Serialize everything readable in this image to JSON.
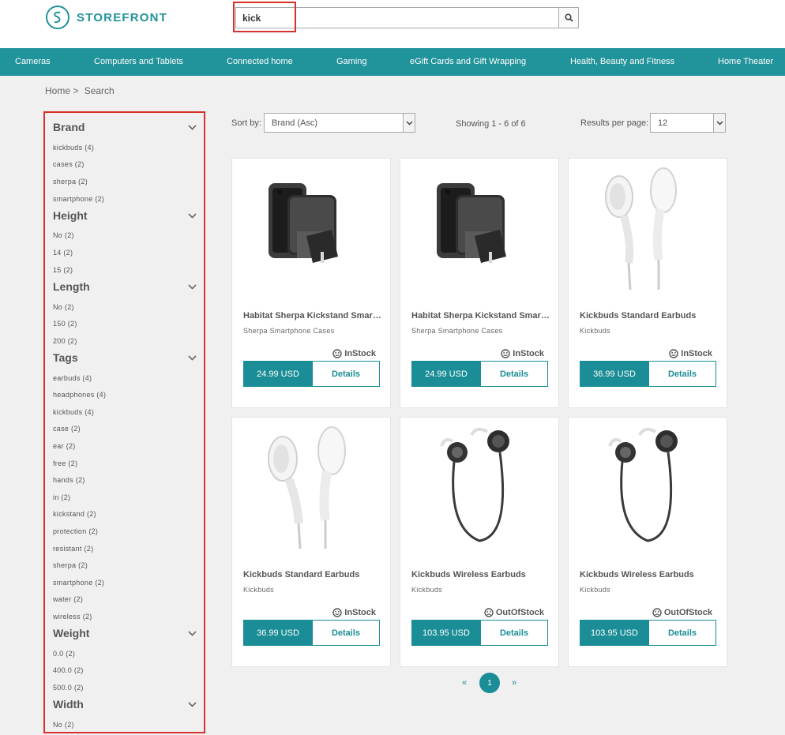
{
  "brand": {
    "name": "STOREFRONT",
    "accent": "#21939a"
  },
  "search": {
    "value": "kick"
  },
  "nav": [
    "Cameras",
    "Computers and Tablets",
    "Connected home",
    "Gaming",
    "eGift Cards and Gift Wrapping",
    "Health, Beauty and Fitness",
    "Home Theater"
  ],
  "breadcrumb": {
    "home": "Home >",
    "current": "Search"
  },
  "facets": [
    {
      "title": "Brand",
      "options": [
        "kickbuds (4)",
        "cases (2)",
        "sherpa (2)",
        "smartphone (2)"
      ]
    },
    {
      "title": "Height",
      "options": [
        "No (2)",
        "14 (2)",
        "15 (2)"
      ]
    },
    {
      "title": "Length",
      "options": [
        "No (2)",
        "150 (2)",
        "200 (2)"
      ]
    },
    {
      "title": "Tags",
      "options": [
        "earbuds (4)",
        "headphones (4)",
        "kickbuds (4)",
        "case (2)",
        "ear (2)",
        "free (2)",
        "hands (2)",
        "in (2)",
        "kickstand (2)",
        "protection (2)",
        "resistant (2)",
        "sherpa (2)",
        "smartphone (2)",
        "water (2)",
        "wireless (2)"
      ]
    },
    {
      "title": "Weight",
      "options": [
        "0.0 (2)",
        "400.0 (2)",
        "500.0 (2)"
      ]
    },
    {
      "title": "Width",
      "options": [
        "No (2)"
      ]
    }
  ],
  "toolbar": {
    "sort_label": "Sort by:",
    "sort_value": "Brand (Asc)",
    "showing": "Showing 1 - 6 of 6",
    "per_page_label": "Results per page:",
    "per_page_value": "12"
  },
  "products": [
    {
      "name": "Habitat Sherpa Kickstand Smartphone Case",
      "brand": "Sherpa Smartphone Cases",
      "stock": "InStock",
      "price": "24.99 USD",
      "details": "Details",
      "image": "phone-case"
    },
    {
      "name": "Habitat Sherpa Kickstand Smartphone Case",
      "brand": "Sherpa Smartphone Cases",
      "stock": "InStock",
      "price": "24.99 USD",
      "details": "Details",
      "image": "phone-case"
    },
    {
      "name": "Kickbuds Standard Earbuds",
      "brand": "Kickbuds",
      "stock": "InStock",
      "price": "36.99 USD",
      "details": "Details",
      "image": "white-earbuds"
    },
    {
      "name": "Kickbuds Standard Earbuds",
      "brand": "Kickbuds",
      "stock": "InStock",
      "price": "36.99 USD",
      "details": "Details",
      "image": "white-earbuds"
    },
    {
      "name": "Kickbuds Wireless Earbuds",
      "brand": "Kickbuds",
      "stock": "OutOfStock",
      "price": "103.95 USD",
      "details": "Details",
      "image": "wireless-earbuds"
    },
    {
      "name": "Kickbuds Wireless Earbuds",
      "brand": "Kickbuds",
      "stock": "OutOfStock",
      "price": "103.95 USD",
      "details": "Details",
      "image": "wireless-earbuds"
    }
  ],
  "pagination": {
    "prev": "«",
    "page": "1",
    "next": "»"
  }
}
